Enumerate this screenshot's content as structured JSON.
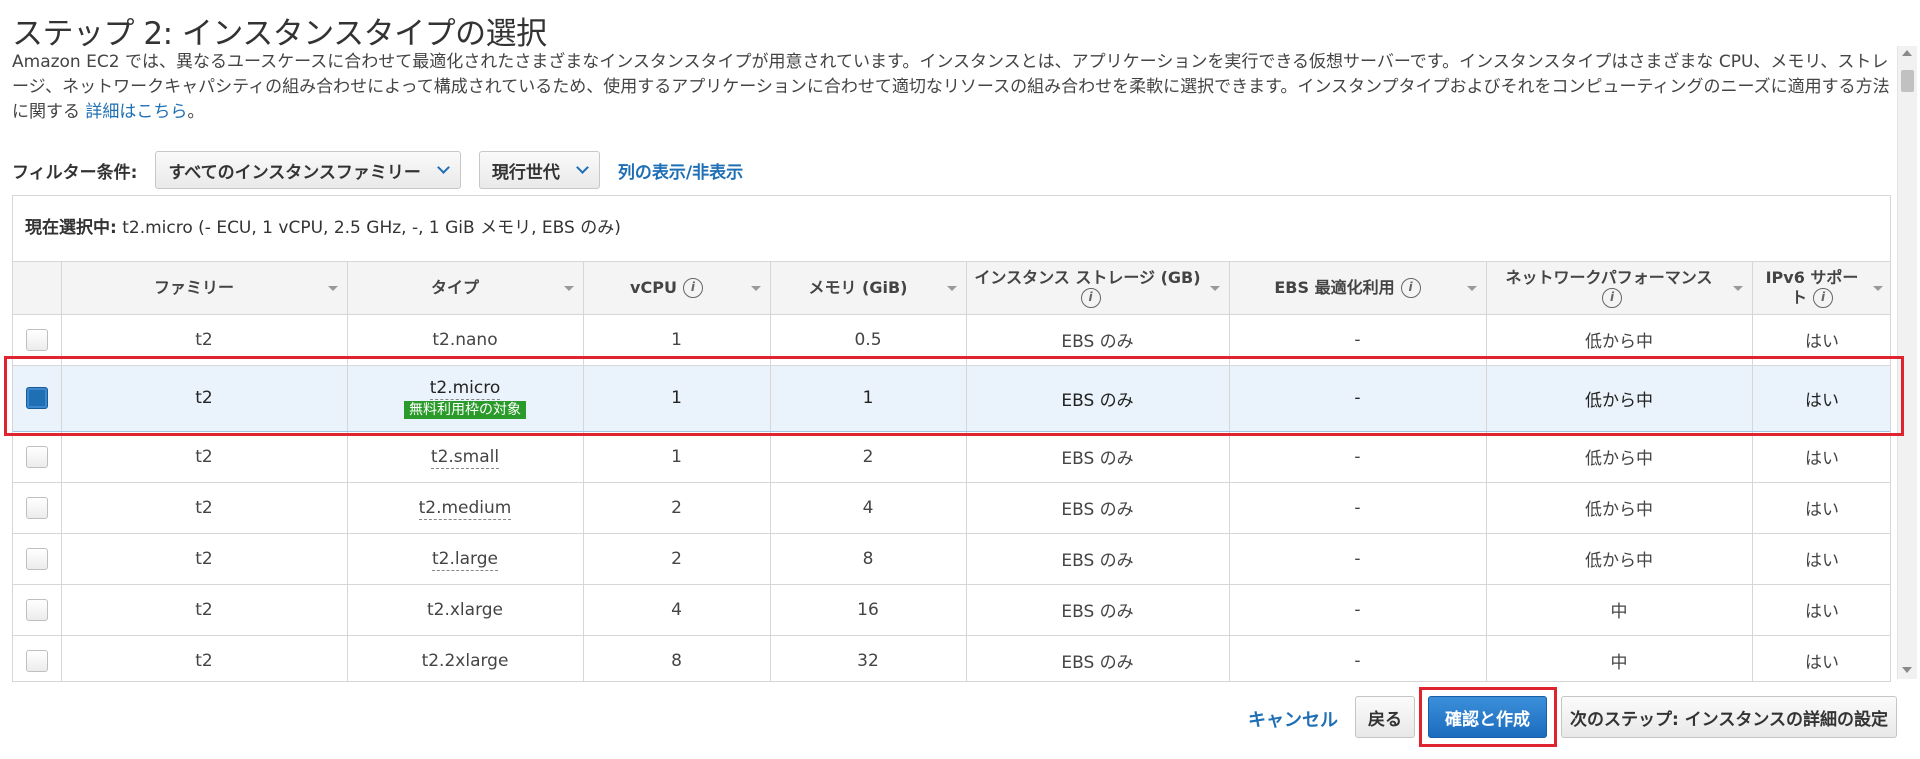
{
  "page": {
    "title": "ステップ 2: インスタンスタイプの選択",
    "description": "Amazon EC2 では、異なるユースケースに合わせて最適化されたさまざまなインスタンスタイプが用意されています。インスタンスとは、アプリケーションを実行できる仮想サーバーです。インスタンスタイプはさまざまな CPU、メモリ、ストレージ、ネットワークキャパシティの組み合わせによって構成されているため、使用するアプリケーションに合わせて適切なリソースの組み合わせを柔軟に選択できます。インスタンプタイプおよびそれをコンピューティングのニーズに適用する方法に関する",
    "learn_more": "詳細はこちら",
    "period": "。"
  },
  "filter": {
    "label": "フィルター条件:",
    "family_value": "すべてのインスタンスファミリー",
    "generation_value": "現行世代",
    "columns_link": "列の表示/非表示"
  },
  "selection": {
    "label": "現在選択中:",
    "value": "t2.micro (- ECU, 1 vCPU, 2.5 GHz, -, 1 GiB メモリ, EBS のみ)"
  },
  "table": {
    "headers": {
      "family": "ファミリー",
      "type": "タイプ",
      "vcpu": "vCPU",
      "memory": "メモリ (GiB)",
      "storage": "インスタンス ストレージ (GB)",
      "ebs": "EBS 最適化利用",
      "network": "ネットワークパフォーマンス",
      "ipv6": "IPv6 サポート"
    },
    "free_tier_badge": "無料利用枠の対象",
    "rows": [
      {
        "family": "t2",
        "type": "t2.nano",
        "vcpu": "1",
        "memory": "0.5",
        "storage": "EBS のみ",
        "ebs": "-",
        "network": "低から中",
        "ipv6": "はい"
      },
      {
        "family": "t2",
        "type": "t2.micro",
        "vcpu": "1",
        "memory": "1",
        "storage": "EBS のみ",
        "ebs": "-",
        "network": "低から中",
        "ipv6": "はい"
      },
      {
        "family": "t2",
        "type": "t2.small",
        "vcpu": "1",
        "memory": "2",
        "storage": "EBS のみ",
        "ebs": "-",
        "network": "低から中",
        "ipv6": "はい"
      },
      {
        "family": "t2",
        "type": "t2.medium",
        "vcpu": "2",
        "memory": "4",
        "storage": "EBS のみ",
        "ebs": "-",
        "network": "低から中",
        "ipv6": "はい"
      },
      {
        "family": "t2",
        "type": "t2.large",
        "vcpu": "2",
        "memory": "8",
        "storage": "EBS のみ",
        "ebs": "-",
        "network": "低から中",
        "ipv6": "はい"
      },
      {
        "family": "t2",
        "type": "t2.xlarge",
        "vcpu": "4",
        "memory": "16",
        "storage": "EBS のみ",
        "ebs": "-",
        "network": "中",
        "ipv6": "はい"
      },
      {
        "family": "t2",
        "type": "t2.2xlarge",
        "vcpu": "8",
        "memory": "32",
        "storage": "EBS のみ",
        "ebs": "-",
        "network": "中",
        "ipv6": "はい"
      }
    ]
  },
  "footer": {
    "cancel": "キャンセル",
    "back": "戻る",
    "review_launch": "確認と作成",
    "next": "次のステップ: インスタンスの詳細の設定"
  },
  "colors": {
    "accent": "#1f6fb5",
    "highlight_border": "#e0242f",
    "free_tier": "#2a9b2a"
  }
}
